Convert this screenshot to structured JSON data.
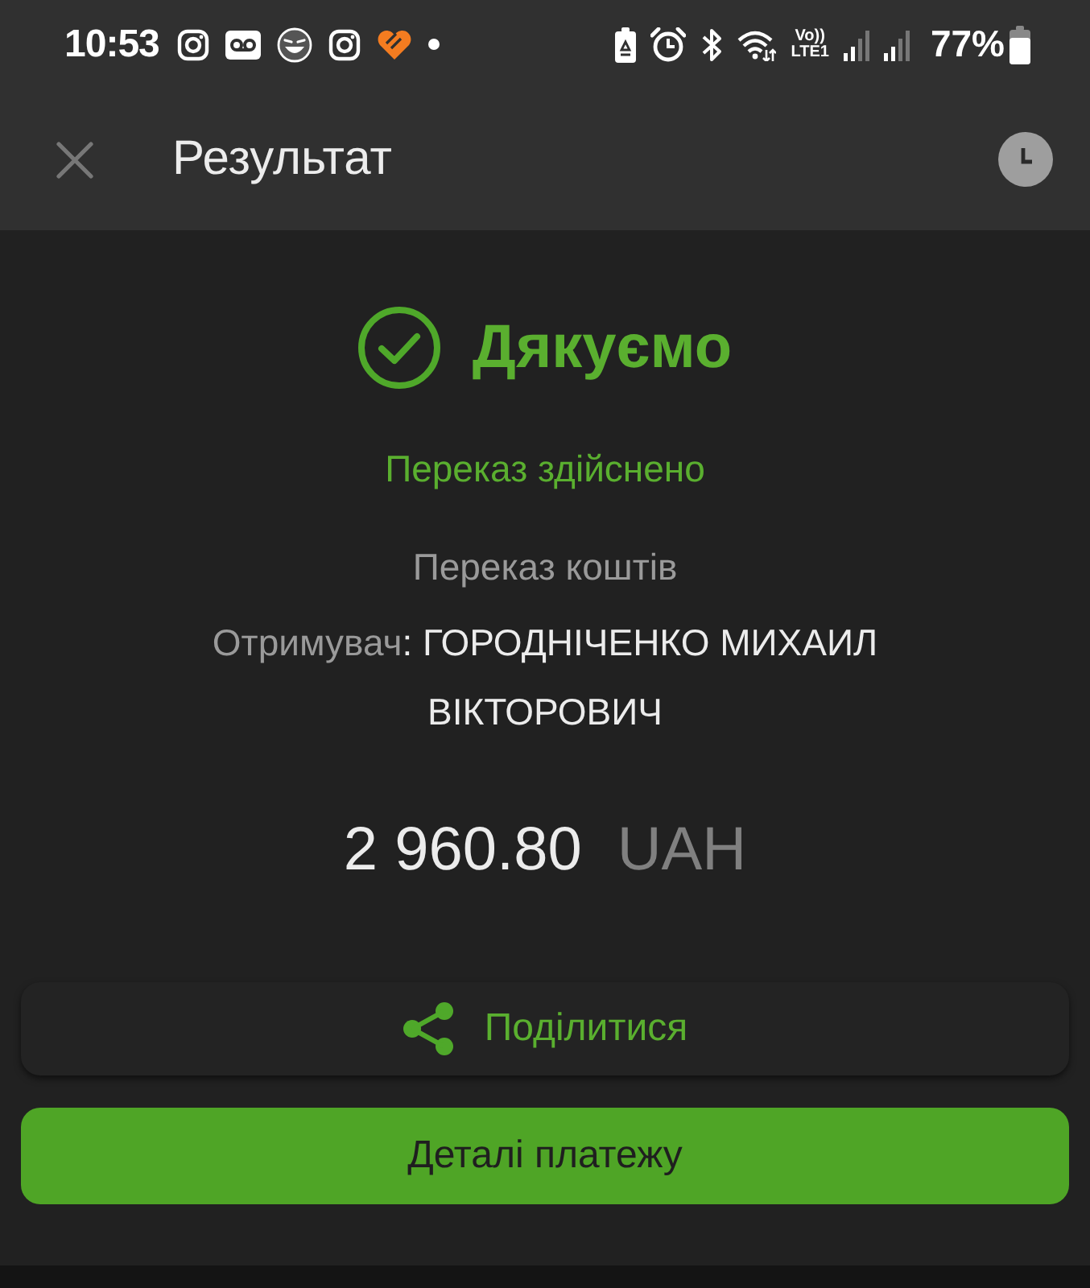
{
  "status_bar": {
    "time": "10:53",
    "volte_label": "Vo))",
    "network_label": "LTE1",
    "battery": "77%"
  },
  "header": {
    "title": "Результат"
  },
  "result": {
    "heading": "Дякуємо",
    "status": "Переказ здійснено",
    "operation": "Переказ коштів",
    "recipient_label": "Отримувач",
    "recipient_name": ": ГОРОДНІЧЕНКО МИХАИЛ ВІКТОРОВИЧ",
    "amount": "2 960.80",
    "currency": "UAH"
  },
  "actions": [
    {
      "kind": "share",
      "label": "Поділитися"
    },
    {
      "kind": "primary",
      "label": "Деталі платежу"
    }
  ]
}
